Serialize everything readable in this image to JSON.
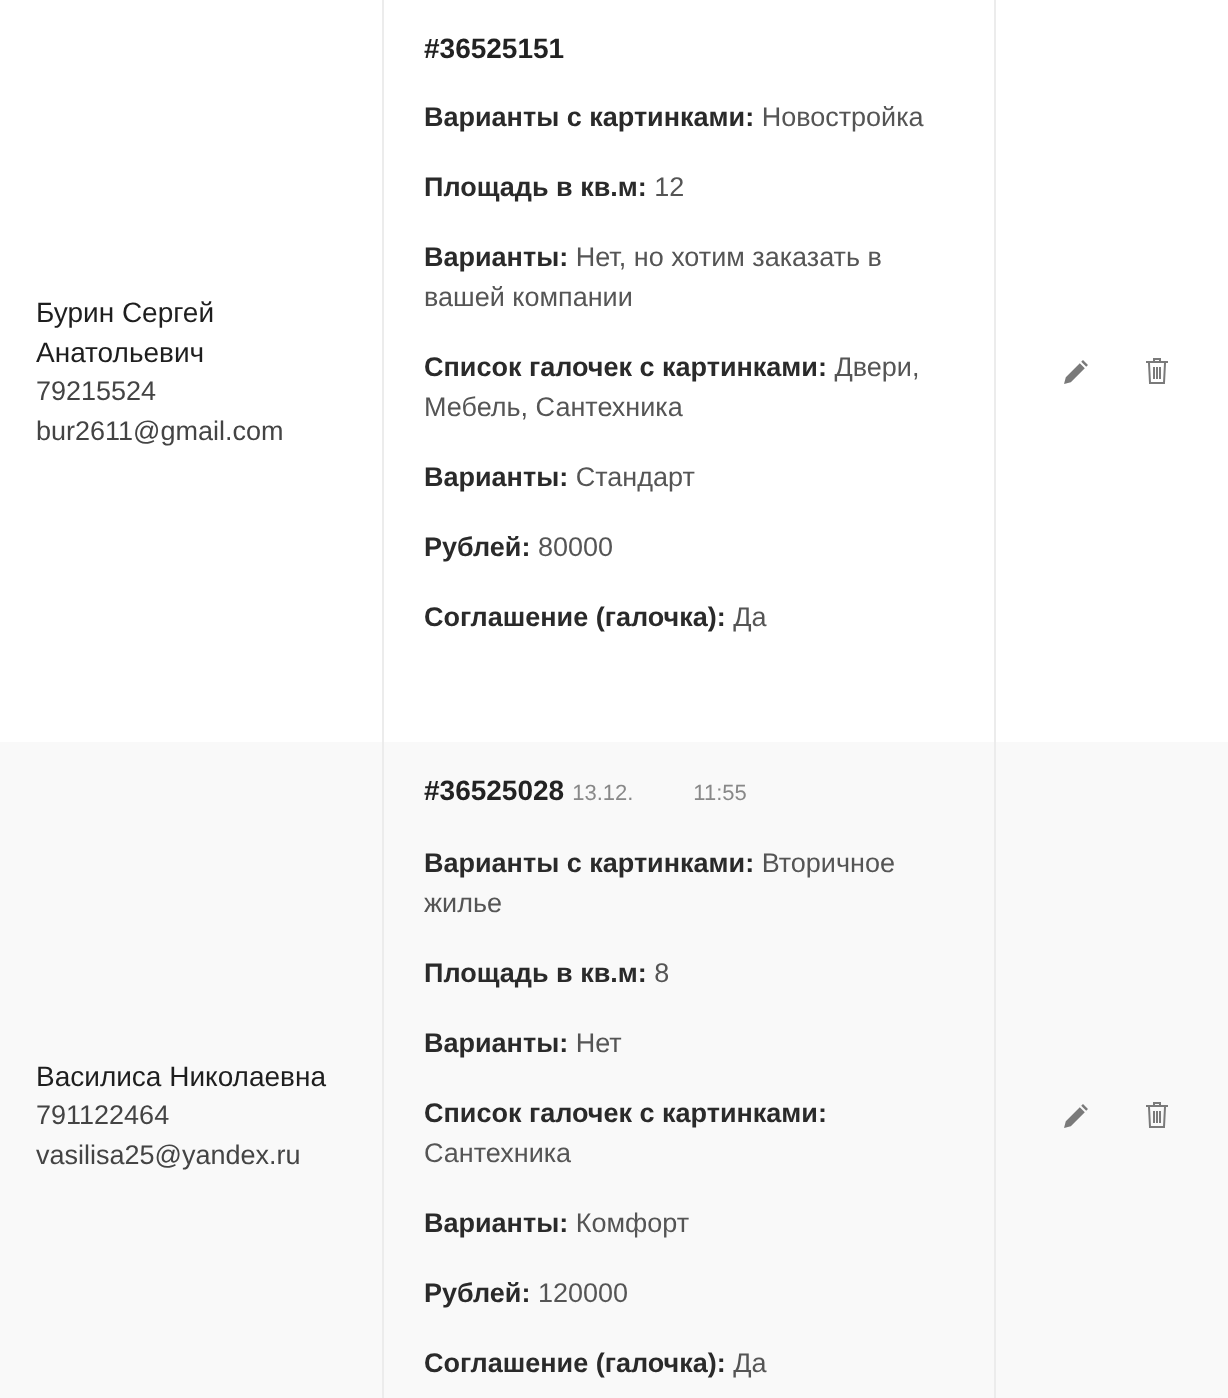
{
  "orders": [
    {
      "contact": {
        "name": "Бурин Сергей Анатольевич",
        "phone": "79215524",
        "email": "bur2611@gmail.com"
      },
      "number": "#36525151",
      "fields": [
        {
          "label": "Варианты с картинками:",
          "value": "Новостройка"
        },
        {
          "label": "Площадь в кв.м:",
          "value": "12"
        },
        {
          "label": "Варианты:",
          "value": "Нет, но хотим заказать в вашей компании"
        },
        {
          "label": "Список галочек с картинками:",
          "value": "Двери, Мебель, Сантехника"
        },
        {
          "label": "Варианты:",
          "value": "Стандарт"
        },
        {
          "label": "Рублей:",
          "value": "80000"
        },
        {
          "label": "Соглашение (галочка):",
          "value": "Да"
        }
      ]
    },
    {
      "contact": {
        "name": "Василиса Николаевна",
        "phone": "791122464",
        "email": "vasilisa25@yandex.ru"
      },
      "number": "#36525028",
      "date": "13.12.",
      "time": "11:55",
      "fields": [
        {
          "label": "Варианты с картинками:",
          "value": "Вторичное жилье"
        },
        {
          "label": "Площадь в кв.м:",
          "value": "8"
        },
        {
          "label": "Варианты:",
          "value": "Нет"
        },
        {
          "label": "Список галочек с картинками:",
          "value": "Сантехника"
        },
        {
          "label": "Варианты:",
          "value": "Комфорт"
        },
        {
          "label": "Рублей:",
          "value": "120000"
        },
        {
          "label": "Соглашение (галочка):",
          "value": "Да"
        }
      ]
    }
  ]
}
